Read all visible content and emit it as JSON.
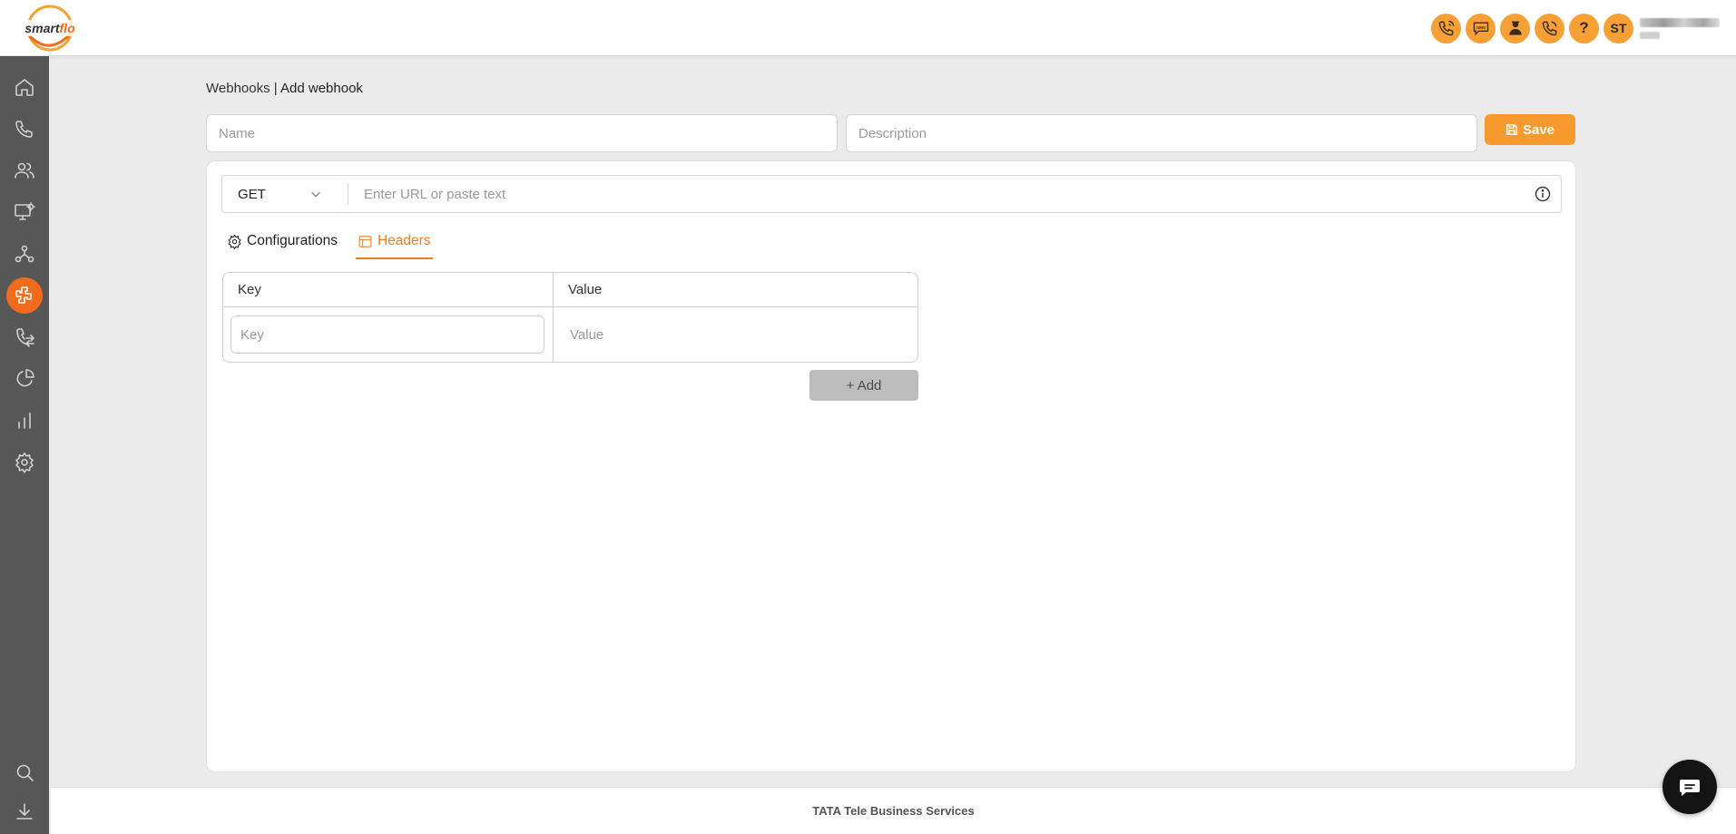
{
  "brand": {
    "logo_text": "smartflo",
    "accent": "#f7a035",
    "active": "#f26b1d"
  },
  "header": {
    "icons": [
      "phone-call-icon",
      "sms-icon",
      "agent-icon",
      "phone-outgoing-icon",
      "help-icon"
    ],
    "avatar_initials": "ST"
  },
  "sidebar": {
    "items": [
      {
        "icon": "home-icon"
      },
      {
        "icon": "phone-icon"
      },
      {
        "icon": "users-icon"
      },
      {
        "icon": "monitor-settings-icon"
      },
      {
        "icon": "network-icon"
      },
      {
        "icon": "integrations-icon",
        "active": true
      },
      {
        "icon": "call-transfer-icon"
      },
      {
        "icon": "pie-chart-icon"
      },
      {
        "icon": "bar-chart-icon"
      },
      {
        "icon": "settings-icon"
      },
      {
        "icon": "search-icon"
      },
      {
        "icon": "download-icon"
      }
    ]
  },
  "breadcrumb": {
    "parent": "Webhooks",
    "separator": " | ",
    "current": "Add webhook"
  },
  "form": {
    "name_placeholder": "Name",
    "description_placeholder": "Description",
    "save_label": "Save"
  },
  "request": {
    "method": "GET",
    "url_placeholder": "Enter URL or paste text"
  },
  "tabs": [
    {
      "label": "Configurations",
      "icon": "gear-icon"
    },
    {
      "label": "Headers",
      "icon": "window-icon",
      "active": true
    }
  ],
  "headers_table": {
    "columns": [
      "Key",
      "Value"
    ],
    "key_placeholder": "Key",
    "value_placeholder": "Value",
    "add_label": "+ Add"
  },
  "footer": {
    "text": "TATA Tele Business Services"
  }
}
